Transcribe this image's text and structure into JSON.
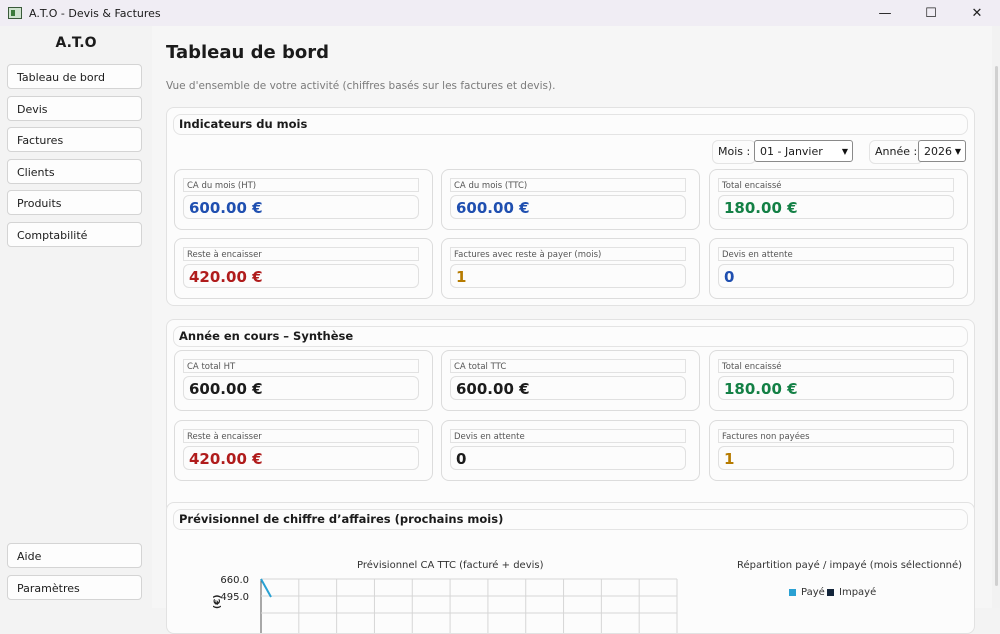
{
  "window": {
    "title": "A.T.O - Devis & Factures"
  },
  "sidebar": {
    "brand": "A.T.O",
    "items": [
      {
        "label": "Tableau de bord"
      },
      {
        "label": "Devis"
      },
      {
        "label": "Factures"
      },
      {
        "label": "Clients"
      },
      {
        "label": "Produits"
      },
      {
        "label": "Comptabilité"
      }
    ],
    "bottom_items": [
      {
        "label": "Aide"
      },
      {
        "label": "Paramètres"
      }
    ]
  },
  "header": {
    "title": "Tableau de bord",
    "subtitle": "Vue d'ensemble de votre activité (chiffres basés sur les factures et devis)."
  },
  "monthly": {
    "section_title": "Indicateurs du mois",
    "month_label": "Mois :",
    "month_value": "01 - Janvier",
    "year_label": "Année :",
    "year_value": "2026",
    "kpis": [
      {
        "label": "CA du mois (HT)",
        "value": "600.00 €"
      },
      {
        "label": "CA du mois (TTC)",
        "value": "600.00 €"
      },
      {
        "label": "Total encaissé",
        "value": "180.00 €"
      },
      {
        "label": "Reste à encaisser",
        "value": "420.00 €"
      },
      {
        "label": "Factures avec reste à payer (mois)",
        "value": "1"
      },
      {
        "label": "Devis en attente",
        "value": "0"
      }
    ]
  },
  "yearly": {
    "section_title": "Année en cours – Synthèse",
    "kpis": [
      {
        "label": "CA total HT",
        "value": "600.00 €"
      },
      {
        "label": "CA total TTC",
        "value": "600.00 €"
      },
      {
        "label": "Total encaissé",
        "value": "180.00 €"
      },
      {
        "label": "Reste à encaisser",
        "value": "420.00 €"
      },
      {
        "label": "Devis en attente",
        "value": "0"
      },
      {
        "label": "Factures non payées",
        "value": "1"
      }
    ]
  },
  "forecast": {
    "section_title": "Prévisionnel de chiffre d’affaires (prochains mois)",
    "chart_data": [
      {
        "type": "line",
        "title": "Prévisionnel CA TTC (facturé + devis)",
        "ylabel": "(€)",
        "yticks": [
          "660.0",
          "495.0"
        ],
        "ylim": [
          0,
          660
        ]
      },
      {
        "type": "pie",
        "title": "Répartition payé / impayé (mois sélectionné)",
        "legend": [
          "Payé",
          "Impayé"
        ],
        "colors": [
          "#2aa1d3",
          "#13253a"
        ]
      }
    ]
  }
}
